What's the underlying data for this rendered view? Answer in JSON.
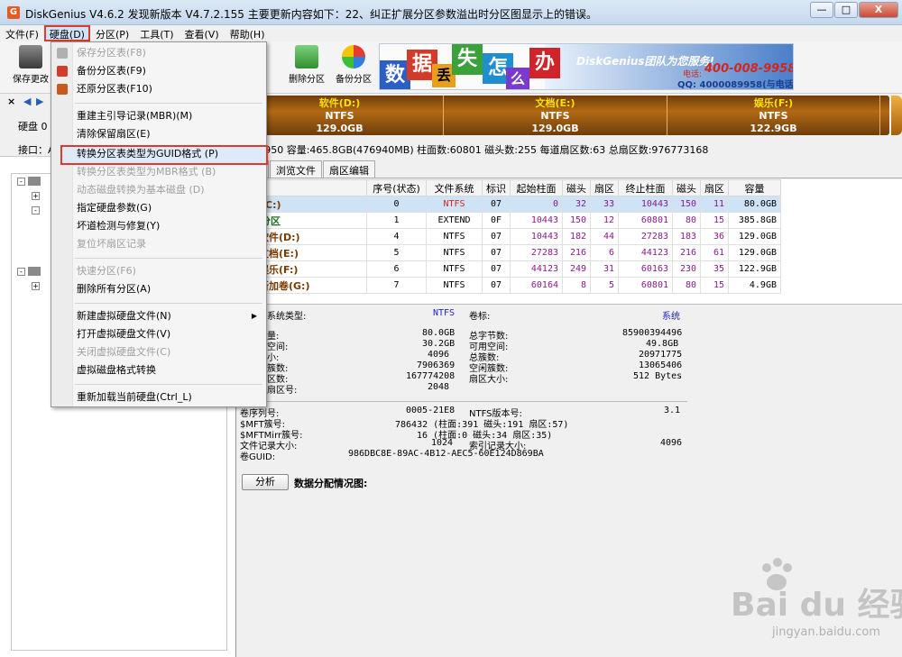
{
  "window": {
    "title": "DiskGenius V4.6.2    发现新版本 V4.7.2.155 主要更新内容如下：22、纠正扩展分区参数溢出时分区图显示上的错误。",
    "minimize": "—",
    "maximize": "□",
    "close": "X"
  },
  "menubar": [
    "文件(F)",
    "硬盘(D)",
    "分区(P)",
    "工具(T)",
    "查看(V)",
    "帮助(H)"
  ],
  "toolbar": {
    "save_label": "保存更改",
    "delete_label": "删除分区",
    "backup_label": "备份分区"
  },
  "banner": {
    "chars": [
      "数",
      "据",
      "丢",
      "失",
      "怎",
      "么",
      "办"
    ],
    "slogan": "DiskGenius团队为您服务!",
    "phone_label": "电话:",
    "phone": "400-008-9958",
    "qq": "QQ: 4000089958(与电话同号)"
  },
  "left_panel": {
    "disk_label": "硬盘 0",
    "iface_label": "接口：A"
  },
  "dropdown": {
    "items": [
      {
        "label": "保存分区表(F8)",
        "disabled": true
      },
      {
        "label": "备份分区表(F9)",
        "disabled": false
      },
      {
        "label": "还原分区表(F10)",
        "disabled": false
      },
      {
        "label": "重建主引导记录(MBR)(M)",
        "disabled": false
      },
      {
        "label": "清除保留扇区(E)",
        "disabled": false
      },
      {
        "label": "转换分区表类型为GUID格式 (P)",
        "disabled": false
      },
      {
        "label": "转换分区表类型为MBR格式 (B)",
        "disabled": true
      },
      {
        "label": "动态磁盘转换为基本磁盘 (D)",
        "disabled": true
      },
      {
        "label": "指定硬盘参数(G)",
        "disabled": false
      },
      {
        "label": "坏道检测与修复(Y)",
        "disabled": false
      },
      {
        "label": "复位坏扇区记录",
        "disabled": true
      },
      {
        "label": "快速分区(F6)",
        "disabled": true
      },
      {
        "label": "删除所有分区(A)",
        "disabled": false
      },
      {
        "label": "新建虚拟硬盘文件(N)",
        "disabled": false
      },
      {
        "label": "打开虚拟硬盘文件(V)",
        "disabled": false
      },
      {
        "label": "关闭虚拟硬盘文件(C)",
        "disabled": true
      },
      {
        "label": "虚拟磁盘格式转换",
        "disabled": false
      },
      {
        "label": "重新加载当前硬盘(Ctrl_L)",
        "disabled": false
      }
    ]
  },
  "diskbar": {
    "partitions": [
      {
        "name": "软件(D:)",
        "fs": "NTFS",
        "size": "129.0GB"
      },
      {
        "name": "文档(E:)",
        "fs": "NTFS",
        "size": "129.0GB"
      },
      {
        "name": "娱乐(F:)",
        "fs": "NTFS",
        "size": "122.9GB"
      }
    ]
  },
  "diskinfo": "I2571950  容量:465.8GB(476940MB)  柱面数:60801  磁头数:255  每道扇区数:63  总扇区数:976773168",
  "tabs": [
    "参数",
    "浏览文件",
    "扇区编辑"
  ],
  "table": {
    "headers": [
      "序号(状态)",
      "文件系统",
      "标识",
      "起始柱面",
      "磁头",
      "扇区",
      "终止柱面",
      "磁头",
      "扇区",
      "容量"
    ],
    "rows": [
      {
        "name": "系统(C:)",
        "idx": "0",
        "fs": "NTFS",
        "id": "07",
        "sc": "0",
        "sh": "32",
        "ss": "33",
        "ec": "10443",
        "eh": "150",
        "es": "11",
        "cap": "80.0GB"
      },
      {
        "name": "扩展分区",
        "idx": "1",
        "fs": "EXTEND",
        "id": "0F",
        "sc": "10443",
        "sh": "150",
        "ss": "12",
        "ec": "60801",
        "eh": "80",
        "es": "15",
        "cap": "385.8GB"
      },
      {
        "name": "软件(D:)",
        "idx": "4",
        "fs": "NTFS",
        "id": "07",
        "sc": "10443",
        "sh": "182",
        "ss": "44",
        "ec": "27283",
        "eh": "183",
        "es": "36",
        "cap": "129.0GB"
      },
      {
        "name": "文档(E:)",
        "idx": "5",
        "fs": "NTFS",
        "id": "07",
        "sc": "27283",
        "sh": "216",
        "ss": "6",
        "ec": "44123",
        "eh": "216",
        "es": "61",
        "cap": "129.0GB"
      },
      {
        "name": "娱乐(F:)",
        "idx": "6",
        "fs": "NTFS",
        "id": "07",
        "sc": "44123",
        "sh": "249",
        "ss": "31",
        "ec": "60163",
        "eh": "230",
        "es": "35",
        "cap": "122.9GB"
      },
      {
        "name": "新加卷(G:)",
        "idx": "7",
        "fs": "NTFS",
        "id": "07",
        "sc": "60164",
        "sh": "8",
        "ss": "5",
        "ec": "60801",
        "eh": "80",
        "es": "15",
        "cap": "4.9GB"
      }
    ]
  },
  "details": {
    "fs_type_label": "系统类型:",
    "fs_type_value": "NTFS",
    "volume_label": "卷标:",
    "volume_value": "系统",
    "left": [
      {
        "label": "量:",
        "value": "80.0GB"
      },
      {
        "label": "空间:",
        "value": "30.2GB"
      },
      {
        "label": "小:",
        "value": "4096"
      },
      {
        "label": "簇数:",
        "value": "7906369"
      },
      {
        "label": "区数:",
        "value": "167774208"
      },
      {
        "label": "扇区号:",
        "value": "2048"
      }
    ],
    "right": [
      {
        "label": "总字节数:",
        "value": "85900394496"
      },
      {
        "label": "可用空间:",
        "value": "49.8GB"
      },
      {
        "label": "总簇数:",
        "value": "20971775"
      },
      {
        "label": "空闲簇数:",
        "value": "13065406"
      },
      {
        "label": "扇区大小:",
        "value": "512 Bytes"
      }
    ],
    "serial_label": "卷序列号:",
    "serial_value": "0005-21E8",
    "ntfs_ver_label": "NTFS版本号:",
    "ntfs_ver_value": "3.1",
    "mft_label": "$MFT簇号:",
    "mft_value": "786432 (柱面:391 磁头:191 扇区:57)",
    "mftmirr_label": "$MFTMirr簇号:",
    "mftmirr_value": "16 (柱面:0 磁头:34 扇区:35)",
    "record_label": "文件记录大小:",
    "record_value": "1024",
    "index_label": "索引记录大小:",
    "index_value": "4096",
    "guid_label": "卷GUID:",
    "guid_value": "986DBC8E-89AC-4B12-AEC5-60E124D869BA",
    "analyze_button": "分析",
    "analyze_label": "数据分配情况图:"
  },
  "watermark": {
    "text": "Bai du 经验",
    "url": "jingyan.baidu.com"
  }
}
